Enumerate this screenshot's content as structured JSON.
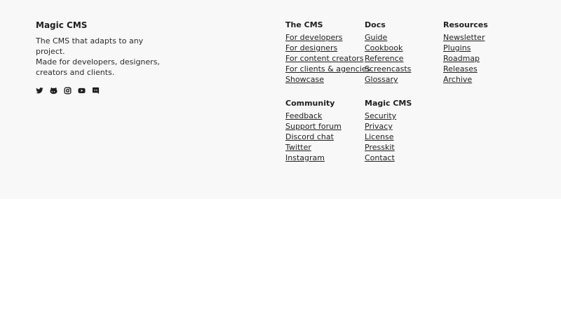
{
  "brand": {
    "title": "Magic CMS",
    "line1": "The CMS that adapts to any",
    "line2": "project.",
    "line3": "Made for developers, designers,",
    "line4": "creators and clients."
  },
  "socials": [
    "twitter-icon",
    "github-icon",
    "instagram-icon",
    "youtube-icon",
    "discord-icon"
  ],
  "columns": {
    "the_cms": {
      "title": "The CMS",
      "links": [
        "For developers",
        "For designers",
        "For content creators",
        "For clients & agencies",
        "Showcase"
      ]
    },
    "docs": {
      "title": "Docs",
      "links": [
        "Guide",
        "Cookbook",
        "Reference",
        "Screencasts",
        "Glossary"
      ]
    },
    "resources": {
      "title": "Resources",
      "links": [
        "Newsletter",
        "Plugins",
        "Roadmap",
        "Releases",
        "Archive"
      ]
    },
    "community": {
      "title": "Community",
      "links": [
        "Feedback",
        "Support forum",
        "Discord chat",
        "Twitter",
        "Instagram"
      ]
    },
    "magic_cms": {
      "title": "Magic CMS",
      "links": [
        "Security",
        "Privacy",
        "License",
        "Presskit",
        "Contact"
      ]
    }
  },
  "colors": {
    "footer_background": "#f8f8f8",
    "page_background": "#ffffff",
    "text": "#1f1f1f"
  }
}
